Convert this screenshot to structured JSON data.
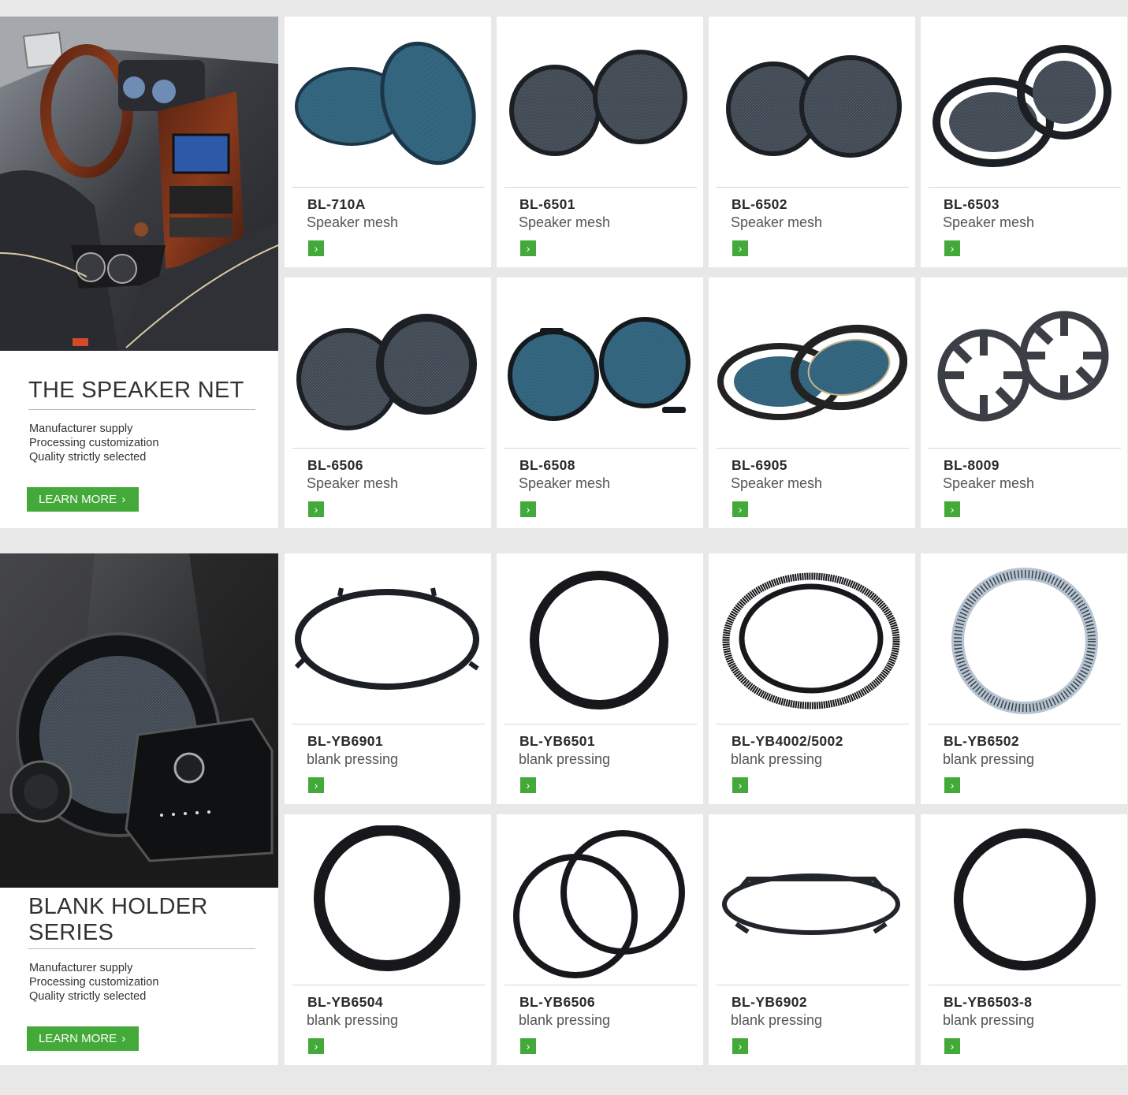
{
  "colors": {
    "accent": "#43a939",
    "page_bg": "#e8e8e8",
    "card_bg": "#ffffff"
  },
  "sections": [
    {
      "title": "THE SPEAKER NET",
      "lines": [
        "Manufacturer supply",
        "Processing customization",
        "Quality strictly selected"
      ],
      "button": "LEARN MORE",
      "products": [
        {
          "code": "BL-710A",
          "name": "Speaker mesh"
        },
        {
          "code": "BL-6501",
          "name": "Speaker mesh"
        },
        {
          "code": "BL-6502",
          "name": "Speaker mesh"
        },
        {
          "code": "BL-6503",
          "name": "Speaker mesh"
        },
        {
          "code": "BL-6506",
          "name": "Speaker mesh"
        },
        {
          "code": "BL-6508",
          "name": "Speaker mesh"
        },
        {
          "code": "BL-6905",
          "name": "Speaker mesh"
        },
        {
          "code": "BL-8009",
          "name": "Speaker mesh"
        }
      ]
    },
    {
      "title_line1": "BLANK HOLDER",
      "title_line2": "SERIES",
      "lines": [
        "Manufacturer supply",
        "Processing customization",
        "Quality strictly selected"
      ],
      "button": "LEARN MORE",
      "products": [
        {
          "code": "BL-YB6901",
          "name": "blank pressing"
        },
        {
          "code": "BL-YB6501",
          "name": "blank pressing"
        },
        {
          "code": "BL-YB4002/5002",
          "name": "blank pressing"
        },
        {
          "code": "BL-YB6502",
          "name": "blank pressing"
        },
        {
          "code": "BL-YB6504",
          "name": "blank pressing"
        },
        {
          "code": "BL-YB6506",
          "name": "blank pressing"
        },
        {
          "code": "BL-YB6902",
          "name": "blank pressing"
        },
        {
          "code": "BL-YB6503-8",
          "name": "blank pressing"
        }
      ]
    }
  ]
}
